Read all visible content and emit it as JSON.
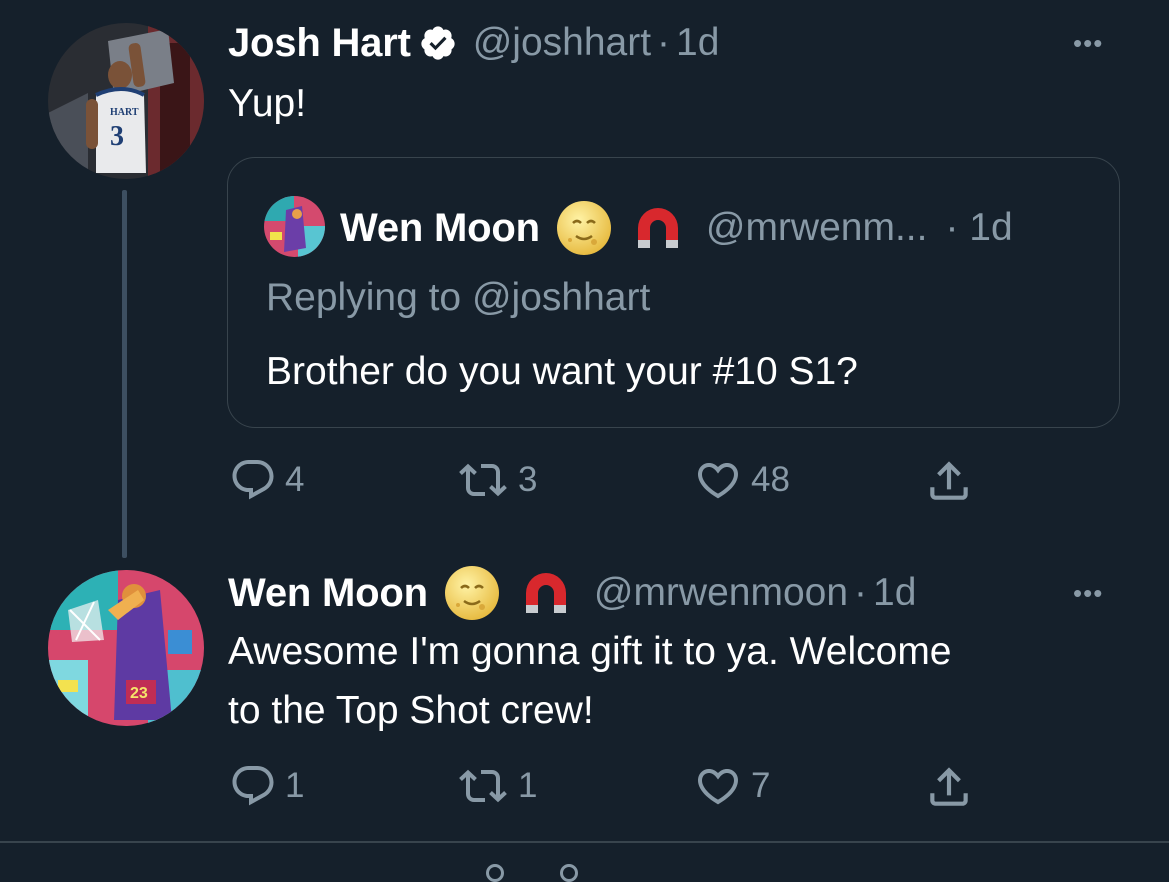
{
  "tweet1": {
    "author_name": "Josh Hart",
    "verified": true,
    "handle": "@joshhart",
    "separator": "·",
    "time": "1d",
    "text": "Yup!",
    "more_label": "•••",
    "avatar_jersey_text": "HART",
    "avatar_jersey_number": "3",
    "actions": {
      "reply_count": "4",
      "retweet_count": "3",
      "like_count": "48"
    }
  },
  "quoted_tweet": {
    "author_name": "Wen Moon",
    "handle": "@mrwenm...",
    "time": "· 1d",
    "replying_to": "Replying to @joshhart",
    "text": "Brother do you want your #10 S1?"
  },
  "tweet2": {
    "author_name": "Wen Moon",
    "handle": "@mrwenmoon",
    "separator": "·",
    "time": "1d",
    "text_line1": "Awesome I'm gonna gift it to ya. Welcome",
    "text_line2": "to the Top Shot crew!",
    "more_label": "•••",
    "avatar_jersey_number": "23",
    "actions": {
      "reply_count": "1",
      "retweet_count": "1",
      "like_count": "7"
    }
  },
  "icons": [
    "verified-badge-icon",
    "full-moon-face-icon",
    "magnet-icon",
    "reply-icon",
    "retweet-icon",
    "like-icon",
    "share-icon",
    "more-icon"
  ],
  "colors": {
    "background": "#15202b",
    "text": "#ffffff",
    "secondary": "#8899a6",
    "border": "#38444d",
    "thread_line": "#3d4f61"
  }
}
